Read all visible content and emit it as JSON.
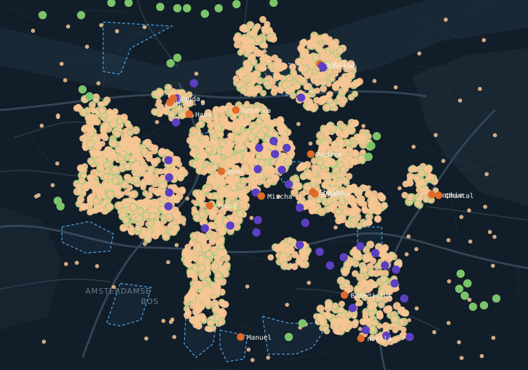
{
  "map": {
    "area_label_lines": [
      "AMSTERDAMSE",
      "BOS"
    ],
    "colors": {
      "background": "#111d28",
      "water": "#1b2a36",
      "road": "#2f3f4d",
      "road_major": "#3a4c5c",
      "listing": "#f6c594",
      "listing_outline": "#9ccf7e",
      "green_marker": "#7cc46a",
      "purple_marker": "#5b3fc4",
      "orange_marker": "#e06a2a",
      "zone_outline": "#4ea3e6"
    },
    "people": [
      {
        "name": "Sabrina",
        "color": "orange"
      },
      {
        "name": "Giacomo",
        "color": "purple"
      },
      {
        "name": "Wanda",
        "color": "orange"
      },
      {
        "name": "Henri B",
        "color": "orange"
      },
      {
        "name": "Hans",
        "color": "orange"
      },
      {
        "name": "Rebecca",
        "color": "orange"
      },
      {
        "name": "Andrea",
        "color": "orange"
      },
      {
        "name": "demi",
        "color": "orange"
      },
      {
        "name": "Mischa",
        "color": "orange"
      },
      {
        "name": "Shaina",
        "color": "orange"
      },
      {
        "name": "Jasmine",
        "color": "orange"
      },
      {
        "name": "Sophia",
        "color": "orange"
      },
      {
        "name": "Chantal",
        "color": "orange"
      },
      {
        "name": "diana",
        "color": "orange"
      },
      {
        "name": "Benedictus",
        "color": "orange"
      },
      {
        "name": "noella",
        "color": "orange"
      },
      {
        "name": "Manuel",
        "color": "orange"
      }
    ]
  }
}
